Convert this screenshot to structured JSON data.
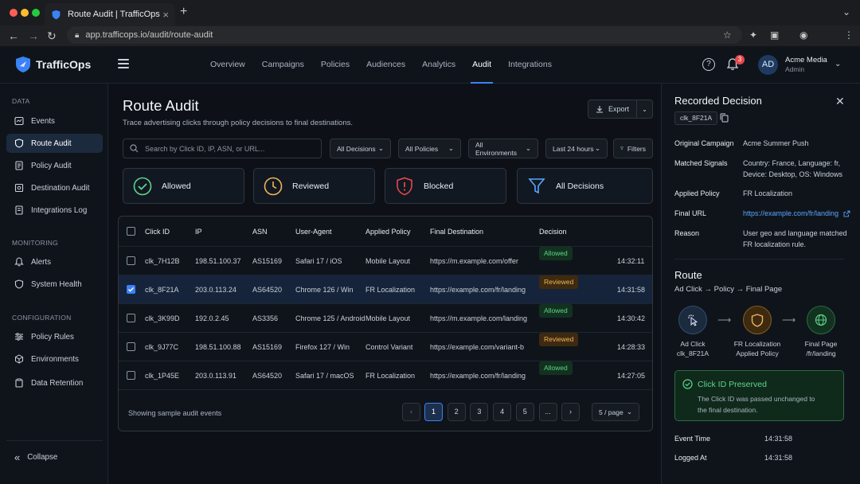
{
  "browser": {
    "tab_title": "Route Audit | TrafficOps",
    "url": "app.trafficops.io/audit/route-audit"
  },
  "app": {
    "brand": "TrafficOps",
    "nav": [
      "Overview",
      "Campaigns",
      "Policies",
      "Audiences",
      "Analytics",
      "Audit",
      "Integrations"
    ],
    "active_nav": "Audit",
    "notifications": "3",
    "user": {
      "initials": "AD",
      "name": "Acme Media",
      "role": "Admin"
    }
  },
  "sidebar": {
    "sections": [
      {
        "title": "DATA",
        "items": [
          {
            "label": "Events",
            "icon": "events-icon"
          },
          {
            "label": "Route Audit",
            "icon": "route-audit-icon",
            "active": true
          },
          {
            "label": "Policy Audit",
            "icon": "policy-audit-icon"
          },
          {
            "label": "Destination Audit",
            "icon": "destination-audit-icon"
          },
          {
            "label": "Integrations Log",
            "icon": "integrations-log-icon"
          }
        ]
      },
      {
        "title": "MONITORING",
        "items": [
          {
            "label": "Alerts",
            "icon": "bell-icon"
          },
          {
            "label": "System Health",
            "icon": "shield-icon"
          }
        ]
      },
      {
        "title": "CONFIGURATION",
        "items": [
          {
            "label": "Policy Rules",
            "icon": "sliders-icon"
          },
          {
            "label": "Environments",
            "icon": "cube-icon"
          },
          {
            "label": "Data Retention",
            "icon": "clipboard-icon"
          }
        ]
      }
    ],
    "collapse_label": "Collapse"
  },
  "page": {
    "title": "Route Audit",
    "subtitle": "Trace advertising clicks through policy decisions to final destinations.",
    "export_label": "Export",
    "search_placeholder": "Search by Click ID, IP, ASN, or URL...",
    "filters": [
      "All Decisions",
      "All Policies",
      "All Environments",
      "Last 24 hours"
    ],
    "filters_button": "Filters",
    "cards": [
      {
        "label": "Allowed",
        "color": "#5fd38b"
      },
      {
        "label": "Reviewed",
        "color": "#f0b35a"
      },
      {
        "label": "Blocked",
        "color": "#e5484d"
      },
      {
        "label": "All Decisions",
        "color": "#58a6ff"
      }
    ]
  },
  "table": {
    "columns": [
      "Click ID",
      "IP",
      "ASN",
      "User-Agent",
      "Applied Policy",
      "Final Destination",
      "Decision"
    ],
    "rows": [
      {
        "id": "clk_7H12B",
        "ip": "198.51.100.37",
        "asn": "AS15169",
        "ua": "Safari 17 / iOS",
        "policy": "Mobile Layout",
        "dest": "https://m.example.com/offer",
        "decision": "Allowed",
        "time": "14:32:11",
        "selected": false
      },
      {
        "id": "clk_8F21A",
        "ip": "203.0.113.24",
        "asn": "AS64520",
        "ua": "Chrome 126 / Win",
        "policy": "FR Localization",
        "dest": "https://example.com/fr/landing",
        "decision": "Reviewed",
        "time": "14:31:58",
        "selected": true
      },
      {
        "id": "clk_3K99D",
        "ip": "192.0.2.45",
        "asn": "AS3356",
        "ua": "Chrome 125 / Android",
        "policy": "Mobile Layout",
        "dest": "https://m.example.com/landing",
        "decision": "Allowed",
        "time": "14:30:42",
        "selected": false
      },
      {
        "id": "clk_9J77C",
        "ip": "198.51.100.88",
        "asn": "AS15169",
        "ua": "Firefox 127 / Win",
        "policy": "Control Variant",
        "dest": "https://example.com/variant-b",
        "decision": "Reviewed",
        "time": "14:28:33",
        "selected": false
      },
      {
        "id": "clk_1P45E",
        "ip": "203.0.113.91",
        "asn": "AS64520",
        "ua": "Safari 17 / macOS",
        "policy": "FR Localization",
        "dest": "https://example.com/fr/landing",
        "decision": "Allowed",
        "time": "14:27:05",
        "selected": false
      }
    ],
    "footer_text": "Showing sample audit events",
    "pages": [
      "1",
      "2",
      "3",
      "4",
      "5",
      "..."
    ],
    "current_page": "1",
    "per_page": "5 / page"
  },
  "panel": {
    "title": "Recorded Decision",
    "click_id": "clk_8F21A",
    "details": [
      {
        "label": "Original Campaign",
        "value": "Acme Summer Push"
      },
      {
        "label": "Matched Signals",
        "value": "Country: France, Language: fr, Device: Desktop, OS: Windows"
      },
      {
        "label": "Applied Policy",
        "value": "FR Localization"
      },
      {
        "label": "Final URL",
        "value": "https://example.com/fr/landing"
      },
      {
        "label": "Reason",
        "value": "User geo and language matched FR localization rule."
      }
    ],
    "route_title": "Route",
    "route_subtitle": "Ad Click → Policy → Final Page",
    "route_nodes": [
      {
        "line1": "Ad Click",
        "line2": "clk_8F21A"
      },
      {
        "line1": "FR Localization",
        "line2": "Applied Policy"
      },
      {
        "line1": "Final Page",
        "line2": "/fr/landing"
      }
    ],
    "preserved_title": "Click ID Preserved",
    "preserved_desc": "The Click ID was passed unchanged to the final destination.",
    "event_time_label": "Event Time",
    "event_time": "14:31:58",
    "logged_at_label": "Logged At",
    "logged_at": "14:31:58"
  }
}
